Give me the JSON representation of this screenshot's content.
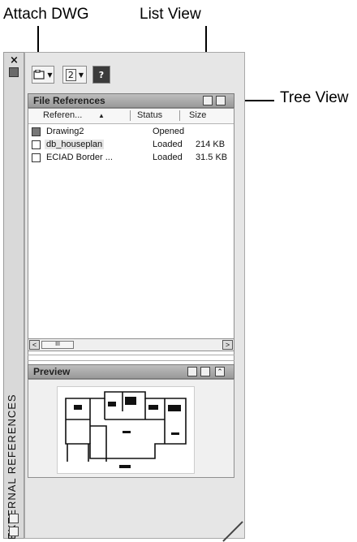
{
  "callouts": {
    "attach_dwg": "Attach DWG",
    "list_view": "List View",
    "tree_view": "Tree View"
  },
  "palette": {
    "title": "EXTERNAL REFERENCES",
    "close_glyph": "×"
  },
  "toolbar": {
    "refresh_label": "2",
    "help_label": "?"
  },
  "file_references": {
    "header": "File References",
    "columns": [
      "Referen...",
      "Status",
      "Size"
    ],
    "sort_indicator": "▲",
    "rows": [
      {
        "name": "Drawing2",
        "status": "Opened",
        "size": ""
      },
      {
        "name": "db_houseplan",
        "status": "Loaded",
        "size": "214 KB"
      },
      {
        "name": "ECIAD Border ...",
        "status": "Loaded",
        "size": "31.5 KB"
      }
    ]
  },
  "scrollbar": {
    "left_glyph": "<",
    "right_glyph": ">",
    "thumb_glyph": "III"
  },
  "preview": {
    "header": "Preview",
    "collapse_glyph": "⌃"
  }
}
